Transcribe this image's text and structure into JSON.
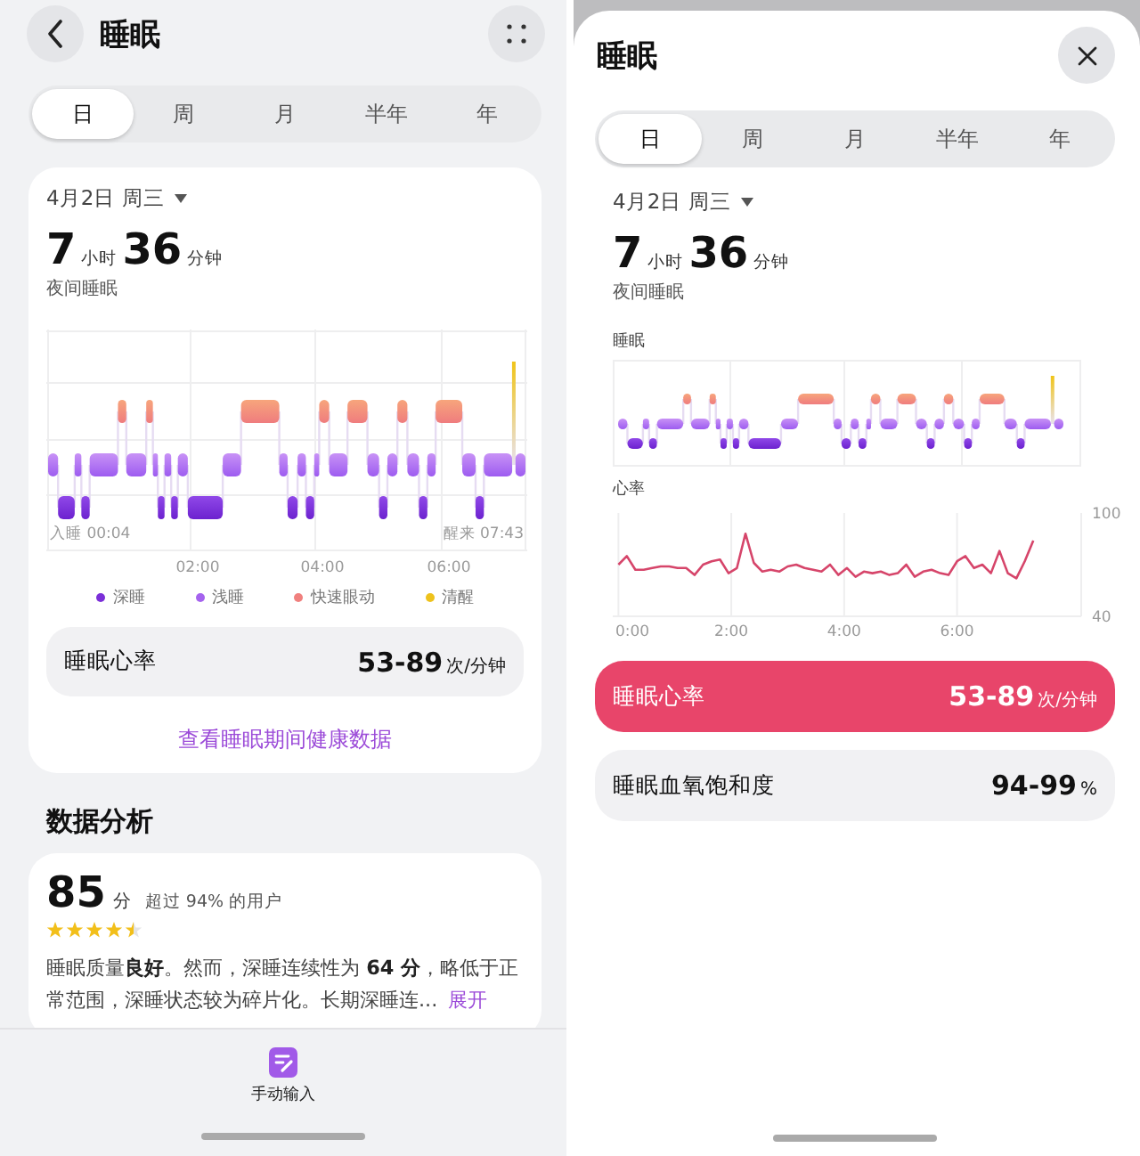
{
  "left_screen": {
    "header": {
      "title": "睡眠"
    },
    "tabs": [
      {
        "label": "日",
        "selected": true
      },
      {
        "label": "周",
        "selected": false
      },
      {
        "label": "月",
        "selected": false
      },
      {
        "label": "半年",
        "selected": false
      },
      {
        "label": "年",
        "selected": false
      }
    ],
    "summary": {
      "date": "4月2日 周三",
      "hours": "7",
      "hours_unit": "小时",
      "minutes": "36",
      "minutes_unit": "分钟",
      "caption": "夜间睡眠"
    },
    "sleep_chart": {
      "start_label": "入睡 00:04",
      "end_label": "醒来 07:43",
      "x_ticks": [
        "02:00",
        "04:00",
        "06:00"
      ]
    },
    "legend": [
      {
        "label": "深睡",
        "color": "#7b2fd8"
      },
      {
        "label": "浅睡",
        "color": "#a563ee"
      },
      {
        "label": "快速眼动",
        "color": "#f0807e"
      },
      {
        "label": "清醒",
        "color": "#eec21c"
      }
    ],
    "metric_rows": [
      {
        "label": "睡眠心率",
        "value": "53-89",
        "unit": "次/分钟",
        "selected": false
      }
    ],
    "link": "查看睡眠期间健康数据",
    "analysis": {
      "heading": "数据分析",
      "score": "85",
      "score_unit": "分",
      "comparison": "超过 94% 的用户",
      "stars": 4.5,
      "text": "睡眠质量**良好**。然而，深睡连续性为 **64 分**，略低于正常范围，深睡状态较为碎片化。长期深睡连...",
      "expand": "展开"
    },
    "bottom_bar": {
      "action": "手动输入"
    }
  },
  "right_screen": {
    "title": "睡眠",
    "tabs": [
      {
        "label": "日",
        "selected": true
      },
      {
        "label": "周",
        "selected": false
      },
      {
        "label": "月",
        "selected": false
      },
      {
        "label": "半年",
        "selected": false
      },
      {
        "label": "年",
        "selected": false
      }
    ],
    "summary": {
      "date": "4月2日 周三",
      "hours": "7",
      "hours_unit": "小时",
      "minutes": "36",
      "minutes_unit": "分钟",
      "caption": "夜间睡眠"
    },
    "sleep_chart": {
      "title": "睡眠"
    },
    "heart_rate_chart": {
      "chart_data": {
        "type": "line",
        "title": "心率",
        "grid": true,
        "xlim": [
          -0.1,
          8.2
        ],
        "ylim": [
          40,
          100
        ],
        "xticks": [
          {
            "value": 0,
            "label": "0:00"
          },
          {
            "value": 2,
            "label": "2:00"
          },
          {
            "value": 4,
            "label": "4:00"
          },
          {
            "value": 6,
            "label": "6:00"
          }
        ],
        "yticks": [
          {
            "value": 100,
            "label": "100"
          },
          {
            "value": 40,
            "label": "40"
          }
        ],
        "x": [
          0,
          0.15,
          0.3,
          0.45,
          0.6,
          0.75,
          0.9,
          1.05,
          1.2,
          1.35,
          1.5,
          1.65,
          1.8,
          1.95,
          2.1,
          2.25,
          2.4,
          2.55,
          2.7,
          2.85,
          3,
          3.15,
          3.3,
          3.45,
          3.6,
          3.75,
          3.9,
          4.05,
          4.2,
          4.35,
          4.5,
          4.65,
          4.8,
          4.95,
          5.1,
          5.25,
          5.4,
          5.55,
          5.7,
          5.85,
          6,
          6.15,
          6.3,
          6.45,
          6.6,
          6.75,
          6.9,
          7.05,
          7.2,
          7.35
        ],
        "series": [
          {
            "color": "#d6456a",
            "values": [
              70,
              75,
              67,
              67,
              68,
              69,
              69,
              68,
              68,
              64,
              70,
              72,
              73,
              65,
              68,
              88,
              71,
              66,
              67,
              66,
              69,
              70,
              68,
              67,
              66,
              70,
              64,
              68,
              63,
              66,
              65,
              66,
              64,
              65,
              70,
              63,
              66,
              67,
              65,
              64,
              72,
              75,
              68,
              70,
              65,
              78,
              65,
              62,
              72,
              84
            ]
          }
        ]
      }
    },
    "metric_rows": [
      {
        "label": "睡眠心率",
        "value": "53-89",
        "unit": "次/分钟",
        "selected": true
      },
      {
        "label": "睡眠血氧饱和度",
        "value": "94-99",
        "unit": "%",
        "selected": false
      }
    ]
  }
}
